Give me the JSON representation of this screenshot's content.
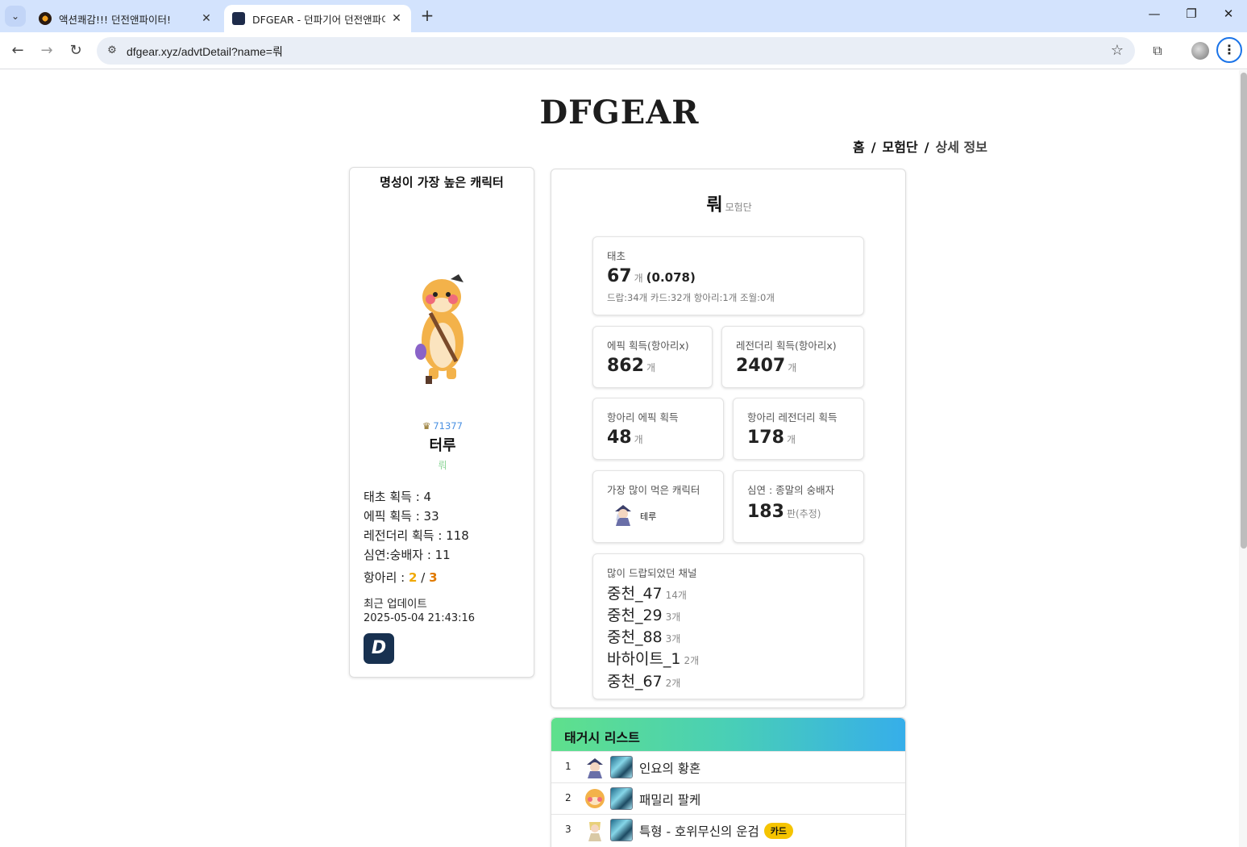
{
  "browser": {
    "tabs": [
      {
        "title": "액션쾌감!!! 던전앤파이터!",
        "active": false
      },
      {
        "title": "DFGEAR - 던파기어 던전앤파이",
        "active": true
      }
    ],
    "url": "dfgear.xyz/advtDetail?name=뤄"
  },
  "site": {
    "logo": "DFGEAR",
    "breadcrumb": {
      "home": "홈",
      "adventure": "모험단",
      "current": "상세 정보",
      "sep": "/"
    }
  },
  "top_character": {
    "title": "명성이 가장 높은 캐릭터",
    "fame": "71377",
    "name": "터루",
    "adventure": "뤄",
    "stats": [
      "태초 획득 : 4",
      "에픽 획득 : 33",
      "레전더리 획득 : 118",
      "심연:숭배자 : 11"
    ],
    "pot_label": "항아리 :",
    "pot_current": "2",
    "pot_sep": "/",
    "pot_total": "3",
    "update_label": "최근 업데이트",
    "update_time": "2025-05-04 21:43:16",
    "dnf_button": "D"
  },
  "adventure": {
    "name": "뤄",
    "suffix": "모험단",
    "taecho": {
      "label": "태초",
      "value": "67",
      "unit": "개",
      "ratio": "(0.078)",
      "breakdown": "드랍:34개 카드:32개 항아리:1개 조월:0개"
    },
    "epic": {
      "label": "에픽 획득(항아리x)",
      "value": "862",
      "unit": "개"
    },
    "legendary": {
      "label": "레전더리 획득(항아리x)",
      "value": "2407",
      "unit": "개"
    },
    "pot_epic": {
      "label": "항아리 에픽 획득",
      "value": "48",
      "unit": "개"
    },
    "pot_legendary": {
      "label": "항아리 레전더리 획득",
      "value": "178",
      "unit": "개"
    },
    "most_char": {
      "label": "가장 많이 먹은 캐릭터",
      "name": "테루"
    },
    "abyss": {
      "label": "심연 : 종말의 숭배자",
      "value": "183",
      "unit": "판(추정)"
    },
    "channels": {
      "label": "많이 드랍되었던 채널",
      "items": [
        {
          "name": "중천_47",
          "count": "14개"
        },
        {
          "name": "중천_29",
          "count": "3개"
        },
        {
          "name": "중천_88",
          "count": "3개"
        },
        {
          "name": "바하이트_1",
          "count": "2개"
        },
        {
          "name": "중천_67",
          "count": "2개"
        }
      ]
    }
  },
  "taegeosi": {
    "title": "태거시 리스트",
    "items": [
      {
        "rank": "1",
        "name": "인요의 황혼",
        "badge": ""
      },
      {
        "rank": "2",
        "name": "패밀리 팔케",
        "badge": ""
      },
      {
        "rank": "3",
        "name": "특형 - 호위무신의 운검",
        "badge": "카드"
      }
    ]
  }
}
